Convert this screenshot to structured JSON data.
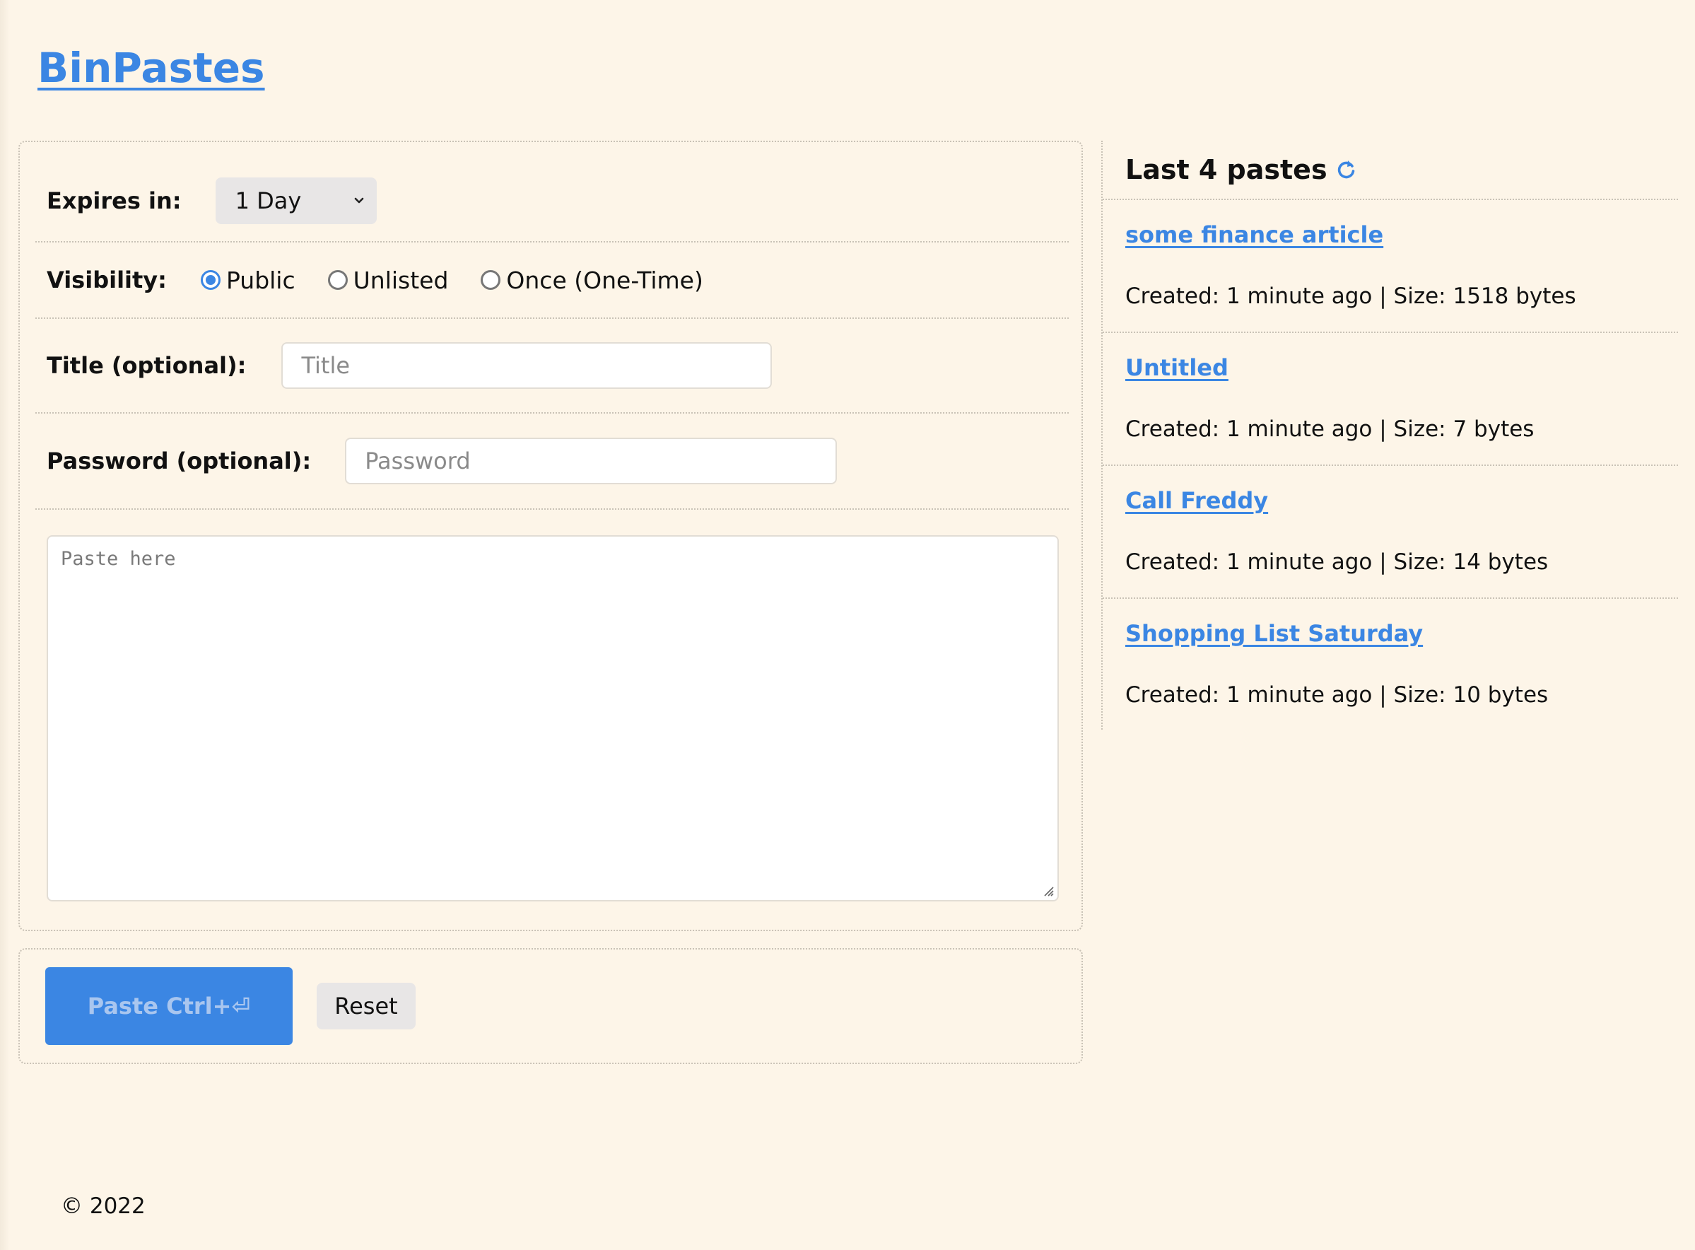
{
  "site": {
    "title": "BinPastes"
  },
  "form": {
    "expires_label": "Expires in:",
    "expires_value": "1 Day",
    "visibility_label": "Visibility:",
    "visibility_options": [
      {
        "label": "Public",
        "selected": true
      },
      {
        "label": "Unlisted",
        "selected": false
      },
      {
        "label": "Once (One-Time)",
        "selected": false
      }
    ],
    "title_label": "Title (optional):",
    "title_placeholder": "Title",
    "password_label": "Password (optional):",
    "password_placeholder": "Password",
    "content_placeholder": "Paste here"
  },
  "actions": {
    "paste_label": "Paste Ctrl+⏎",
    "reset_label": "Reset"
  },
  "sidebar": {
    "title": "Last 4 pastes",
    "items": [
      {
        "title": "some finance article",
        "meta": "Created: 1 minute ago | Size: 1518 bytes"
      },
      {
        "title": "Untitled",
        "meta": "Created: 1 minute ago | Size: 7 bytes"
      },
      {
        "title": "Call Freddy",
        "meta": "Created: 1 minute ago | Size: 14 bytes"
      },
      {
        "title": "Shopping List Saturday",
        "meta": "Created: 1 minute ago | Size: 10 bytes"
      }
    ]
  },
  "footer": {
    "text": "© 2022"
  },
  "colors": {
    "background": "#fdf5e8",
    "accent": "#3b86e3",
    "button_text_disabled": "#a9c6ef"
  },
  "icons": {
    "select_arrow": "chevron-down-icon",
    "refresh": "refresh-icon",
    "resize": "resize-handle-icon"
  }
}
